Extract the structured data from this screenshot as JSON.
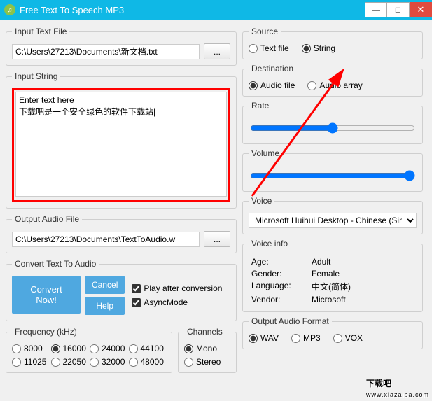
{
  "window": {
    "title": "Free Text To Speech MP3",
    "min": "—",
    "max": "□",
    "close": "✕"
  },
  "left": {
    "inputFile": {
      "legend": "Input Text File",
      "value": "C:\\Users\\27213\\Documents\\新文档.txt",
      "browse": "..."
    },
    "inputString": {
      "legend": "Input String",
      "value": "Enter text here\n下载吧是一个安全绿色的软件下载站|"
    },
    "outputFile": {
      "legend": "Output Audio File",
      "value": "C:\\Users\\27213\\Documents\\TextToAudio.w",
      "browse": "..."
    },
    "convert": {
      "legend": "Convert Text To Audio",
      "convertNow": "Convert Now!",
      "cancel": "Cancel",
      "help": "Help",
      "playAfter": "Play after conversion",
      "asyncMode": "AsyncMode"
    },
    "frequency": {
      "legend": "Frequency (kHz)",
      "options": [
        "8000",
        "16000",
        "24000",
        "44100",
        "11025",
        "22050",
        "32000",
        "48000"
      ],
      "selected": "16000"
    },
    "channels": {
      "legend": "Channels",
      "options": [
        "Mono",
        "Stereo"
      ],
      "selected": "Mono"
    }
  },
  "right": {
    "source": {
      "legend": "Source",
      "options": [
        "Text file",
        "String"
      ],
      "selected": "String"
    },
    "destination": {
      "legend": "Destination",
      "options": [
        "Audio file",
        "Audio array"
      ],
      "selected": "Audio file"
    },
    "rate": {
      "legend": "Rate",
      "value": 50
    },
    "volume": {
      "legend": "Volume",
      "value": 100
    },
    "voice": {
      "legend": "Voice",
      "selected": "Microsoft Huihui Desktop - Chinese (Sim"
    },
    "voiceInfo": {
      "legend": "Voice info",
      "ageLabel": "Age:",
      "ageValue": "Adult",
      "genderLabel": "Gender:",
      "genderValue": "Female",
      "languageLabel": "Language:",
      "languageValue": "中文(简体)",
      "vendorLabel": "Vendor:",
      "vendorValue": "Microsoft"
    },
    "outputFormat": {
      "legend": "Output Audio Format",
      "options": [
        "WAV",
        "MP3",
        "VOX"
      ],
      "selected": "WAV"
    }
  },
  "watermark": {
    "big": "下载吧",
    "small": "www.xiazaiba.com"
  }
}
